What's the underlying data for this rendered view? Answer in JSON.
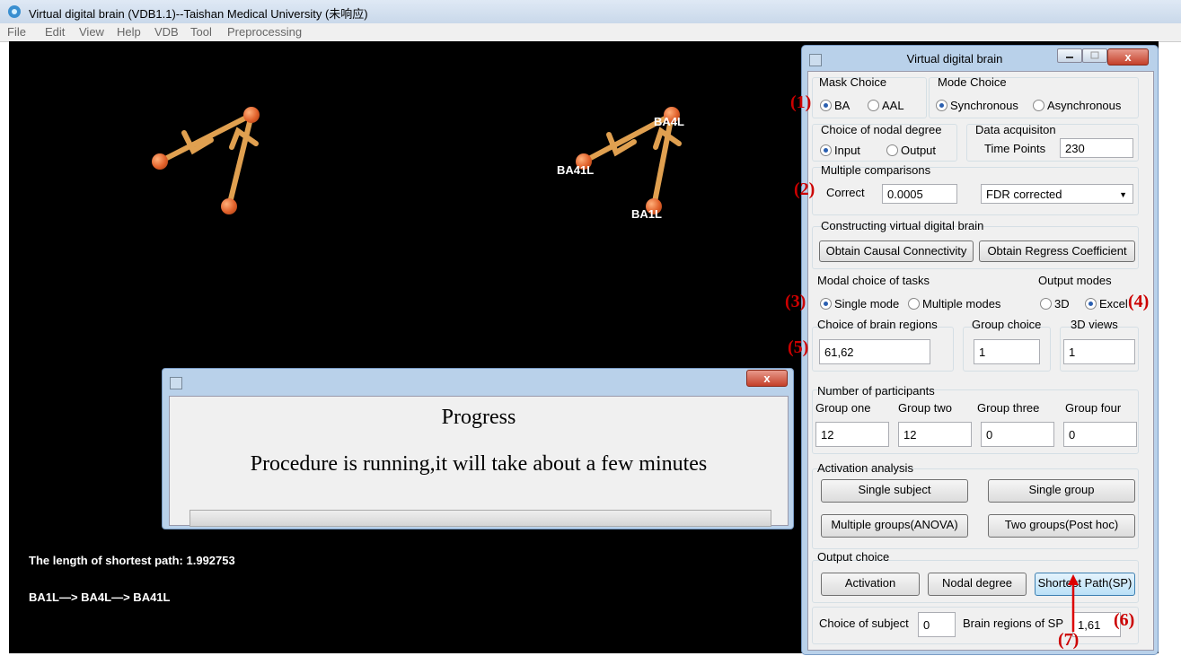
{
  "window": {
    "title": "Virtual digital brain (VDB1.1)--Taishan Medical University (未响应)"
  },
  "menu": [
    "File",
    "Edit",
    "View",
    "Help",
    "VDB",
    "Tool",
    "Preprocessing"
  ],
  "canvas": {
    "labels": {
      "ba4l": "BA4L",
      "ba41l": "BA41L",
      "ba1l": "BA1L"
    },
    "shortest_path_text": "The length of shortest path:  1.992753",
    "path_text": "BA1L—> BA4L—> BA41L"
  },
  "progress": {
    "title": "Progress",
    "message": "Procedure is running,it will take about a few minutes",
    "close": "x"
  },
  "vdb": {
    "title": "Virtual   digital   brain",
    "close": "x",
    "mask_choice": {
      "label": "Mask Choice",
      "opt1": "BA",
      "opt2": "AAL"
    },
    "mode_choice": {
      "label": "Mode Choice",
      "opt1": "Synchronous",
      "opt2": "Asynchronous"
    },
    "nodal": {
      "label": "Choice of nodal degree",
      "opt1": "Input",
      "opt2": "Output"
    },
    "acq": {
      "label": "Data acquisiton",
      "tp_label": "Time Points",
      "tp_value": "230"
    },
    "mc": {
      "label": "Multiple comparisons",
      "correct_label": "Correct",
      "correct_value": "0.0005",
      "method": "FDR corrected"
    },
    "construct": {
      "label": "Constructing virtual digital brain",
      "btn1": "Obtain  Causal Connectivity",
      "btn2": "Obtain Regress Coefficient"
    },
    "tasks": {
      "label": "Modal choice of tasks",
      "opt1": "Single mode",
      "opt2": "Multiple modes"
    },
    "outmodes": {
      "label": "Output modes",
      "opt1": "3D",
      "opt2": "Excel"
    },
    "regions": {
      "label": "Choice of brain regions",
      "value": "61,62"
    },
    "group": {
      "label": "Group choice",
      "value": "1"
    },
    "views": {
      "label": "3D views",
      "value": "1"
    },
    "participants": {
      "label": "Number of participants",
      "g1": "Group one",
      "g2": "Group two",
      "g3": "Group three",
      "g4": "Group four",
      "v1": "12",
      "v2": "12",
      "v3": "0",
      "v4": "0"
    },
    "activation": {
      "label": "Activation analysis",
      "b1": "Single subject",
      "b2": "Single group",
      "b3": "Multiple groups(ANOVA)",
      "b4": "Two groups(Post hoc)"
    },
    "output": {
      "label": "Output choice",
      "b1": "Activation",
      "b2": "Nodal degree",
      "b3": "Shortest Path(SP)"
    },
    "subject": {
      "label": "Choice of subject",
      "value": "0"
    },
    "sp_regions": {
      "label": "Brain regions of SP",
      "value": "1,61"
    }
  },
  "annotations": [
    "(1)",
    "(2)",
    "(3)",
    "(4)",
    "(5)",
    "(6)",
    "(7)"
  ]
}
